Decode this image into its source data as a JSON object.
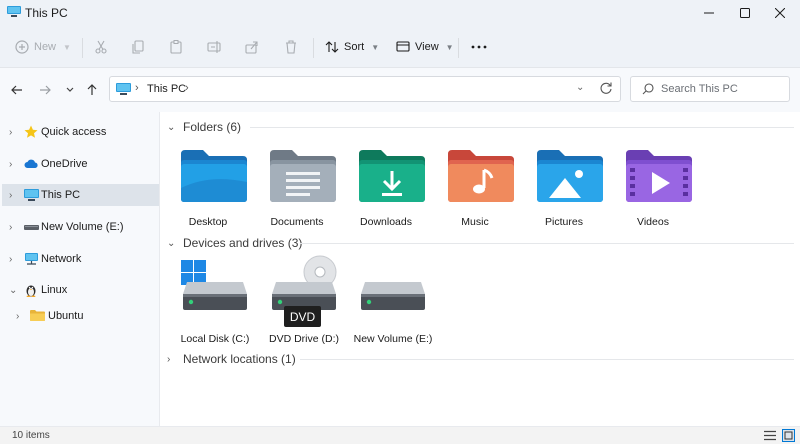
{
  "window": {
    "title": "This PC",
    "controls": {
      "minimize_icon": "minimize-icon",
      "maximize_icon": "maximize-icon",
      "close_icon": "close-icon"
    }
  },
  "toolbar": {
    "new_label": "New",
    "sort_label": "Sort",
    "view_label": "View",
    "disabled_actions": [
      "cut-icon",
      "copy-icon",
      "paste-icon",
      "rename-icon",
      "share-icon",
      "delete-icon"
    ],
    "more_icon": "more-icon"
  },
  "address": {
    "crumb": "This PC",
    "search_placeholder": "Search This PC"
  },
  "sidebar": {
    "items": [
      {
        "label": "Quick access",
        "icon": "star-icon",
        "expanded": false
      },
      {
        "label": "OneDrive",
        "icon": "cloud-icon",
        "expanded": false
      },
      {
        "label": "This PC",
        "icon": "pc-icon",
        "expanded": false,
        "selected": true
      },
      {
        "label": "New Volume (E:)",
        "icon": "drive-icon",
        "expanded": false
      },
      {
        "label": "Network",
        "icon": "network-icon",
        "expanded": false
      },
      {
        "label": "Linux",
        "icon": "penguin-icon",
        "expanded": true
      },
      {
        "label": "Ubuntu",
        "icon": "folder-icon",
        "expanded": false,
        "child": true
      }
    ]
  },
  "content": {
    "folders_header": "Folders (6)",
    "folders": [
      {
        "label": "Desktop",
        "icon": "desktop-folder-icon"
      },
      {
        "label": "Documents",
        "icon": "documents-folder-icon"
      },
      {
        "label": "Downloads",
        "icon": "downloads-folder-icon"
      },
      {
        "label": "Music",
        "icon": "music-folder-icon"
      },
      {
        "label": "Pictures",
        "icon": "pictures-folder-icon"
      },
      {
        "label": "Videos",
        "icon": "videos-folder-icon"
      }
    ],
    "drives_header": "Devices and drives (3)",
    "drives": [
      {
        "label": "Local Disk (C:)",
        "icon": "system-drive-icon"
      },
      {
        "label": "DVD Drive (D:)",
        "icon": "dvd-drive-icon"
      },
      {
        "label": "New Volume (E:)",
        "icon": "drive-icon"
      }
    ],
    "dvd_tooltip": "DVD",
    "network_header": "Network locations (1)"
  },
  "status": {
    "item_count": "10 items"
  },
  "colors": {
    "accent": "#0078d4",
    "chrome": "#eef2f7",
    "selected": "#dde3ea"
  }
}
